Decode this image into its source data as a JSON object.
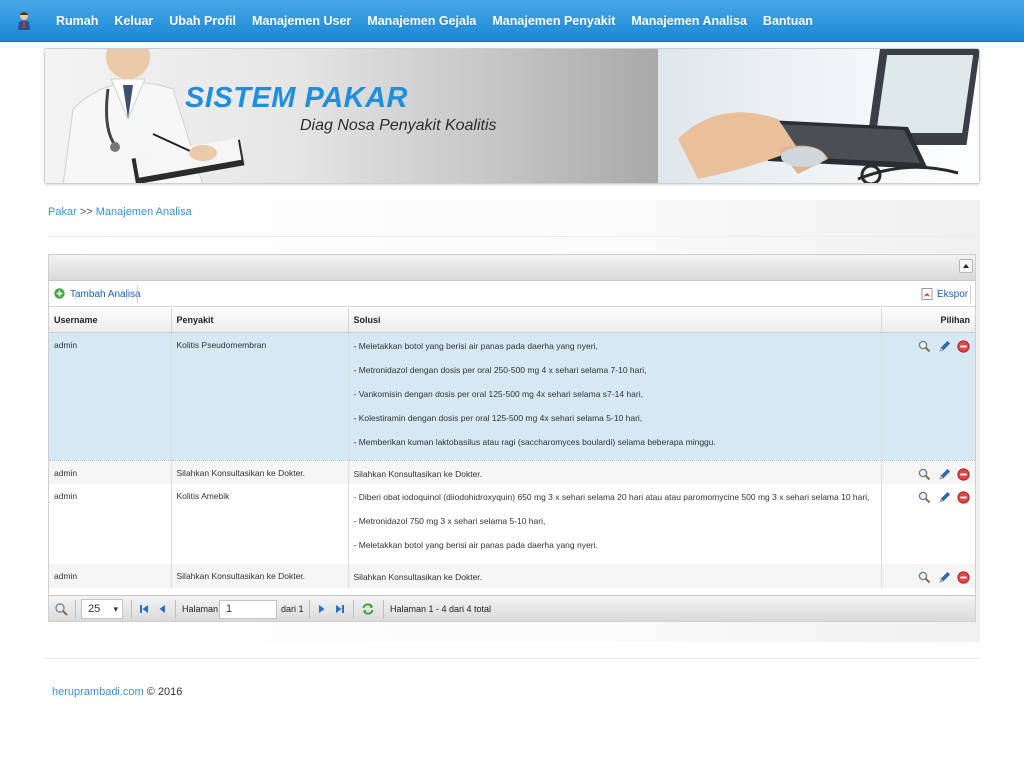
{
  "nav": {
    "items": [
      "Rumah",
      "Keluar",
      "Ubah Profil",
      "Manajemen User",
      "Manajemen Gejala",
      "Manajemen Penyakit",
      "Manajemen Analisa",
      "Bantuan"
    ]
  },
  "banner": {
    "title": "SISTEM PAKAR",
    "subtitle": "Diag Nosa Penyakit Koalitis"
  },
  "breadcrumb": {
    "root": "Pakar",
    "separator": ">>",
    "current": "Manajemen Analisa"
  },
  "toolbar": {
    "add_label": "Tambah Analisa",
    "export_label": "Ekspor"
  },
  "table": {
    "columns": [
      "Username",
      "Penyakit",
      "Solusi",
      "Pilihan"
    ],
    "rows": [
      {
        "username": "admin",
        "penyakit": "Kolitis Pseudomembran",
        "solusi": [
          "- Meletakkan botol yang berisi air panas pada daerha yang nyeri,",
          "- Metronidazol dengan dosis per oral 250-500 mg 4 x sehari selama 7-10 hari,",
          "- Vankomisin dengan dosis per oral 125-500 mg 4x sehari selama s7-14 hari,",
          "- Kolestiramin dengan dosis per oral 125-500 mg 4x sehari selama 5-10 hari,",
          "- Memberikan kuman laktobasilus atau ragi (saccharomyces boulardi) selama beberapa minggu."
        ]
      },
      {
        "username": "admin",
        "penyakit": "Silahkan Konsultasikan ke Dokter.",
        "solusi": [
          "Silahkan Konsultasikan ke Dokter."
        ]
      },
      {
        "username": "admin",
        "penyakit": "Kolitis Amebik",
        "solusi": [
          "- Diberi obat iodoquinol (diiodohidroxyquin) 650 mg 3 x sehari selama 20 hari atau atau paromomycine 500 mg 3 x sehari selama 10 hari,",
          "- Metronidazol 750 mg 3 x sehari selama 5-10 hari,",
          "- Meletakkan botol yang berisi air panas pada daerha yang nyeri."
        ]
      },
      {
        "username": "admin",
        "penyakit": "Silahkan Konsultasikan ke Dokter.",
        "solusi": [
          "Silahkan Konsultasikan ke Dokter."
        ]
      }
    ]
  },
  "pager": {
    "page_size": "25",
    "page_label": "Halaman",
    "page_value": "1",
    "of_label": "dari 1",
    "status": "Halaman 1 - 4 dari 4 total"
  },
  "footer": {
    "link": "heruprambadi.com",
    "text": "© 2016"
  },
  "colors": {
    "nav": "#1b87d6",
    "accent": "#1f8fdc",
    "selected_row": "#d5e8f3"
  }
}
